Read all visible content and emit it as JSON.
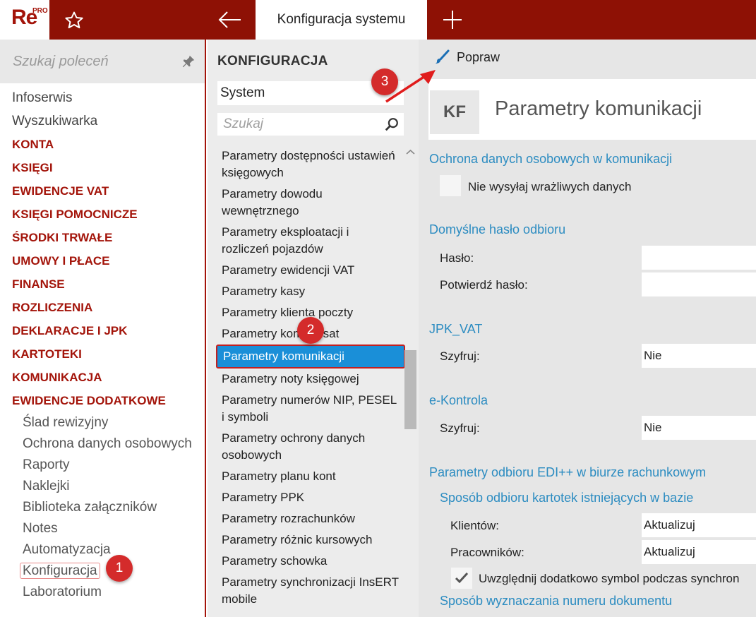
{
  "app": {
    "logo_text": "Re",
    "logo_superscript": "PRO",
    "active_tab": "Konfiguracja systemu"
  },
  "sidebar": {
    "search_placeholder": "Szukaj poleceń",
    "items": [
      {
        "label": "Infoserwis",
        "kind": "plain"
      },
      {
        "label": "Wyszukiwarka",
        "kind": "plain"
      },
      {
        "label": "KONTA",
        "kind": "category"
      },
      {
        "label": "KSIĘGI",
        "kind": "category"
      },
      {
        "label": "EWIDENCJE VAT",
        "kind": "category"
      },
      {
        "label": "KSIĘGI POMOCNICZE",
        "kind": "category"
      },
      {
        "label": "ŚRODKI TRWAŁE",
        "kind": "category"
      },
      {
        "label": "UMOWY I PŁACE",
        "kind": "category"
      },
      {
        "label": "FINANSE",
        "kind": "category"
      },
      {
        "label": "ROZLICZENIA",
        "kind": "category"
      },
      {
        "label": "DEKLARACJE I JPK",
        "kind": "category"
      },
      {
        "label": "KARTOTEKI",
        "kind": "category"
      },
      {
        "label": "KOMUNIKACJA",
        "kind": "category"
      },
      {
        "label": "EWIDENCJE DODATKOWE",
        "kind": "category"
      }
    ],
    "subitems": [
      {
        "label": "Ślad rewizyjny"
      },
      {
        "label": "Ochrona danych osobowych"
      },
      {
        "label": "Raporty"
      },
      {
        "label": "Naklejki"
      },
      {
        "label": "Biblioteka załączników"
      },
      {
        "label": "Notes"
      },
      {
        "label": "Automatyzacja"
      },
      {
        "label": "Konfiguracja"
      },
      {
        "label": "Laboratorium"
      }
    ]
  },
  "config": {
    "title": "KONFIGURACJA",
    "group_selected": "System",
    "search_placeholder": "Szukaj",
    "items": [
      "Parametry dostępności ustawień księgowych",
      "Parametry dowodu wewnętrznego",
      "Parametry eksploatacji i rozliczeń pojazdów",
      "Parametry ewidencji VAT",
      "Parametry kasy",
      "Parametry klienta poczty",
      "Parametry kompensat",
      "Parametry komunikacji",
      "Parametry noty księgowej",
      "Parametry numerów NIP, PESEL i symboli",
      "Parametry ochrony danych osobowych",
      "Parametry planu kont",
      "Parametry PPK",
      "Parametry rozrachunków",
      "Parametry różnic kursowych",
      "Parametry schowka",
      "Parametry synchronizacji InsERT mobile"
    ]
  },
  "detail": {
    "toolbar_edit": "Popraw",
    "badge": "KF",
    "title": "Parametry komunikacji",
    "sec_privacy": "Ochrona danych osobowych w komunikacji",
    "chk_no_sensitive": "Nie wysyłaj wrażliwych danych",
    "sec_password": "Domyślne hasło odbioru",
    "lbl_password": "Hasło:",
    "lbl_confirm": "Potwierdź hasło:",
    "sec_jpk": "JPK_VAT",
    "lbl_encrypt1": "Szyfruj:",
    "val_encrypt1": "Nie",
    "sec_ekontrola": "e-Kontrola",
    "lbl_encrypt2": "Szyfruj:",
    "val_encrypt2": "Nie",
    "sec_edi": "Parametry odbioru EDI++ w biurze rachunkowym",
    "sec_existing": "Sposób odbioru kartotek istniejących w bazie",
    "lbl_clients": "Klientów:",
    "val_clients": "Aktualizuj",
    "lbl_employees": "Pracowników:",
    "val_employees": "Aktualizuj",
    "chk_symbol": "Uwzględnij dodatkowo symbol podczas synchron",
    "sec_docnum": "Sposób wyznaczania numeru dokumentu"
  },
  "badges": {
    "b1": "1",
    "b2": "2",
    "b3": "3"
  },
  "colors": {
    "brand": "#8e1105",
    "accent_blue": "#2c8cc1",
    "selection": "#1a8fd8",
    "badge": "#d42b2b"
  }
}
